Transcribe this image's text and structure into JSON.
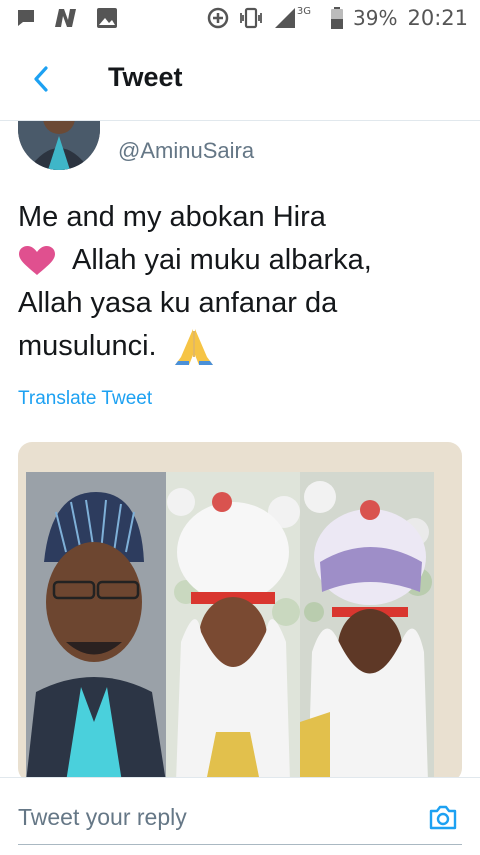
{
  "status_bar": {
    "battery": "39%",
    "time": "20:21",
    "network": "3G"
  },
  "header": {
    "title": "Tweet"
  },
  "tweet": {
    "handle": "@AminuSaira",
    "text_line1": "Me and my abokan Hira",
    "text_line2": "Allah yai muku albarka,",
    "text_line3": "Allah yasa ku anfanar da",
    "text_line4": "musulunci.",
    "translate": "Translate Tweet"
  },
  "reply": {
    "placeholder": "Tweet your reply"
  },
  "colors": {
    "accent": "#1da1f2",
    "text": "#14171a",
    "muted": "#657786"
  }
}
